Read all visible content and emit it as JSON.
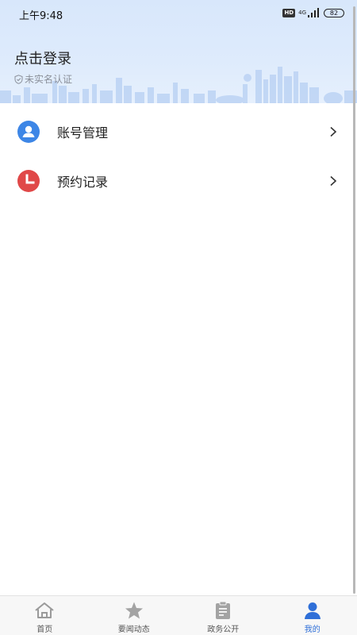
{
  "status_bar": {
    "time": "上午9:48",
    "hd": "HD",
    "network": "4G",
    "battery": "82"
  },
  "profile": {
    "login_prompt": "点击登录",
    "verify_status": "未实名认证"
  },
  "menu": {
    "items": [
      {
        "label": "账号管理",
        "icon": "user-circle-icon",
        "color": "#3d86e6"
      },
      {
        "label": "预约记录",
        "icon": "clock-icon",
        "color": "#e04848"
      }
    ]
  },
  "tabbar": {
    "tabs": [
      {
        "label": "首页",
        "icon": "home-icon"
      },
      {
        "label": "要闻动态",
        "icon": "star-icon"
      },
      {
        "label": "政务公开",
        "icon": "clipboard-icon"
      },
      {
        "label": "我的",
        "icon": "user-icon",
        "active": true
      }
    ],
    "active_color": "#2f6fd8",
    "inactive_color": "#9a9a9a"
  }
}
